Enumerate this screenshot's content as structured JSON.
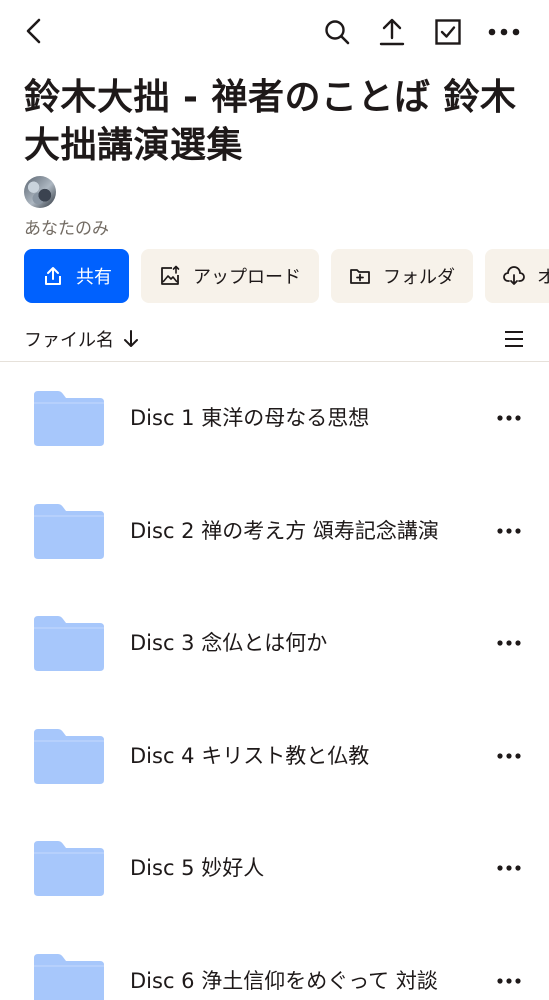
{
  "header": {
    "back_icon": "chevron-left-icon",
    "search_icon": "search-icon",
    "upload_icon": "upload-icon",
    "select_icon": "checkbox-icon",
    "more_icon": "more-horizontal-icon"
  },
  "folder": {
    "title": "鈴木大拙 - 禅者のことば 鈴木大拙講演選集",
    "owner": "あなたのみ"
  },
  "actions": [
    {
      "label": "共有",
      "icon": "share-icon"
    },
    {
      "label": "アップロード",
      "icon": "upload-photo-icon"
    },
    {
      "label": "フォルダ",
      "icon": "new-folder-icon"
    },
    {
      "label": "オ",
      "icon": "cloud-download-icon"
    }
  ],
  "sort": {
    "label": "ファイル名",
    "direction_icon": "arrow-down-icon",
    "view_icon": "list-view-icon"
  },
  "items": [
    {
      "name": "Disc 1 東洋の母なる思想",
      "icon": "folder-icon"
    },
    {
      "name": "Disc 2 禅の考え方 頌寿記念講演",
      "icon": "folder-icon"
    },
    {
      "name": "Disc 3 念仏とは何か",
      "icon": "folder-icon"
    },
    {
      "name": "Disc 4 キリスト教と仏教",
      "icon": "folder-icon"
    },
    {
      "name": "Disc 5 妙好人",
      "icon": "folder-icon"
    },
    {
      "name": "Disc 6 浄土信仰をめぐって 対談",
      "icon": "folder-icon"
    }
  ],
  "colors": {
    "primary": "#0061fe",
    "secondary_bg": "#f7f2ea",
    "folder": "#a7c7fb",
    "text": "#1e1919",
    "muted": "#736c64"
  }
}
